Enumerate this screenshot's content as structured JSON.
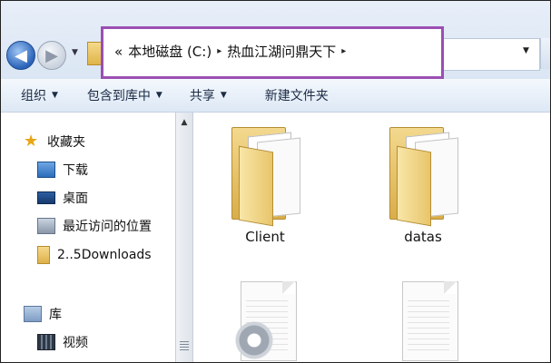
{
  "address": {
    "prefix": "«",
    "drive": "本地磁盘 (C:)",
    "folder": "热血江湖问鼎天下",
    "sep": "▸"
  },
  "toolbar": {
    "organize": "组织",
    "include": "包含到库中",
    "share": "共享",
    "new_folder": "新建文件夹"
  },
  "sidebar": {
    "favorites": "收藏夹",
    "items": [
      "下载",
      "桌面",
      "最近访问的位置",
      "2..5Downloads"
    ],
    "library": "库",
    "library_items": [
      "视频"
    ]
  },
  "files": [
    {
      "name": "Client",
      "type": "folder"
    },
    {
      "name": "datas",
      "type": "folder"
    },
    {
      "name": "",
      "type": "doc-gear"
    },
    {
      "name": "",
      "type": "doc"
    }
  ],
  "icons": {
    "back": "back-arrow-icon",
    "forward": "forward-arrow-icon",
    "favorites": "star-icon",
    "download": "download-folder-icon",
    "desktop": "desktop-icon",
    "recent": "recent-places-icon",
    "folder": "folder-icon",
    "library": "library-icon",
    "video": "video-library-icon"
  },
  "colors": {
    "highlight_border": "#9a4fb2",
    "toolbar_bg": "#dde8f5"
  }
}
